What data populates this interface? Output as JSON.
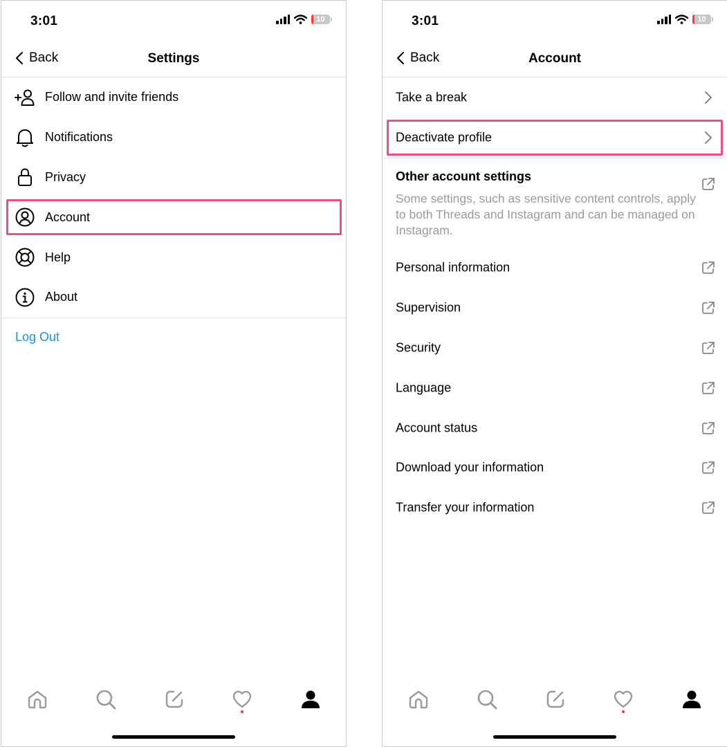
{
  "colors": {
    "link": "#1d8ff2",
    "highlight": "#ee4d86",
    "notification_dot": "#ff3040",
    "secondary_text": "#9a9a9a"
  },
  "left_screen": {
    "status": {
      "time": "3:01",
      "battery": "10"
    },
    "nav": {
      "back_label": "Back",
      "title": "Settings"
    },
    "menu": [
      {
        "label": "Follow and invite friends",
        "icon": "add-person-icon"
      },
      {
        "label": "Notifications",
        "icon": "bell-icon"
      },
      {
        "label": "Privacy",
        "icon": "lock-icon"
      },
      {
        "label": "Account",
        "icon": "account-circle-icon",
        "highlighted": true
      },
      {
        "label": "Help",
        "icon": "lifebuoy-icon"
      },
      {
        "label": "About",
        "icon": "info-icon"
      }
    ],
    "logout_label": "Log Out",
    "tabs": [
      "home-icon",
      "search-icon",
      "compose-icon",
      "heart-icon",
      "profile-icon"
    ]
  },
  "right_screen": {
    "status": {
      "time": "3:01",
      "battery": "10"
    },
    "nav": {
      "back_label": "Back",
      "title": "Account"
    },
    "top_rows": [
      {
        "label": "Take a break",
        "trail": "chevron-right-icon"
      },
      {
        "label": "Deactivate profile",
        "trail": "chevron-right-icon",
        "highlighted": true
      }
    ],
    "other_settings": {
      "title": "Other account settings",
      "description": "Some settings, such as sensitive content controls, apply to both Threads and Instagram and can be managed on Instagram.",
      "trail": "external-link-icon"
    },
    "external_rows": [
      {
        "label": "Personal information",
        "trail": "external-link-icon"
      },
      {
        "label": "Supervision",
        "trail": "external-link-icon"
      },
      {
        "label": "Security",
        "trail": "external-link-icon"
      },
      {
        "label": "Language",
        "trail": "external-link-icon"
      },
      {
        "label": "Account status",
        "trail": "external-link-icon"
      },
      {
        "label": "Download your information",
        "trail": "external-link-icon"
      },
      {
        "label": "Transfer your information",
        "trail": "external-link-icon"
      }
    ],
    "tabs": [
      "home-icon",
      "search-icon",
      "compose-icon",
      "heart-icon",
      "profile-icon"
    ]
  }
}
